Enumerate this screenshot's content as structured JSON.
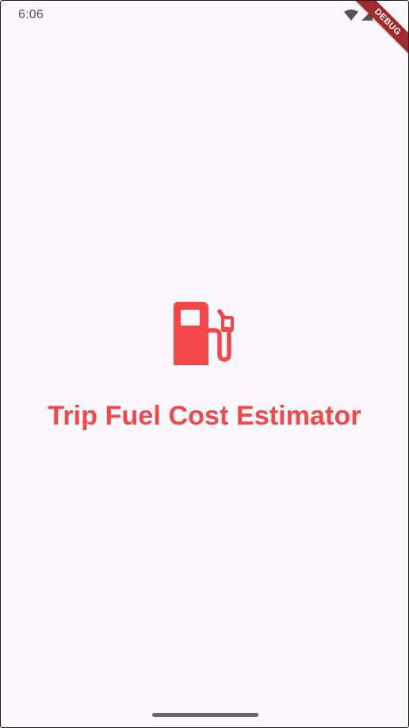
{
  "status_bar": {
    "time": "6:06",
    "icons": [
      "wifi-icon",
      "cellular-signal-icon",
      "battery-icon"
    ]
  },
  "debug_banner": {
    "label": "DEBUG"
  },
  "splash": {
    "icon": "fuel-pump-icon",
    "title": "Trip Fuel Cost Estimator"
  },
  "colors": {
    "accent": "#f4474a",
    "background": "#fdf7fe",
    "status_text": "#555555"
  }
}
